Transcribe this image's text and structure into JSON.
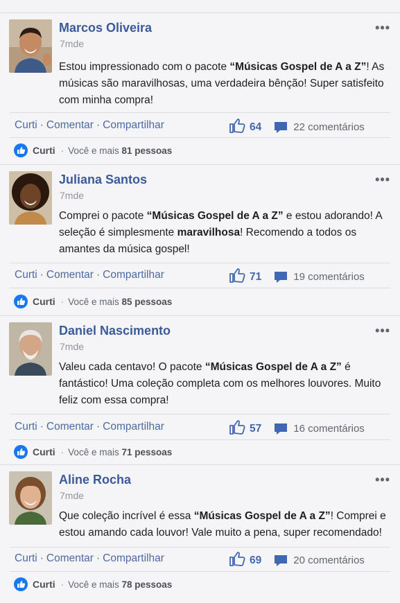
{
  "posts": [
    {
      "name": "Marcos Oliveira",
      "time": "7mde",
      "body_before": "Estou impressionado com o pacote ",
      "body_bold": "“Músicas Gospel de A a Z”",
      "body_after": "! As músicas são maravilhosas, uma verdadeira bênção! Super satisfeito com minha compra!",
      "action_like": "Curti",
      "action_comment": "Comentar",
      "action_share": "Compartilhar",
      "likes": "64",
      "comments": "22 comentários",
      "reaction_label": "Curti",
      "reaction_text": "Você e mais ",
      "reaction_count": "81 pessoas",
      "avatar_bg": "#8a6a52"
    },
    {
      "name": "Juliana Santos",
      "time": "7mde",
      "body_before": "Comprei o pacote ",
      "body_bold": "“Músicas Gospel de A a Z”",
      "body_after": " e estou adorando! A seleção é simplesmente ",
      "body_bold2": "maravilhosa",
      "body_after2": "! Recomendo a todos os amantes da música gospel!",
      "action_like": "Curti",
      "action_comment": "Comentar",
      "action_share": "Compartilhar",
      "likes": "71",
      "comments": "19 comentários",
      "reaction_label": "Curti",
      "reaction_text": "Você e mais ",
      "reaction_count": "85 pessoas",
      "avatar_bg": "#5a3a24"
    },
    {
      "name": "Daniel Nascimento",
      "time": "7mde",
      "body_before": "Valeu cada centavo! O pacote ",
      "body_bold": "“Músicas Gospel de A a Z”",
      "body_after": " é fantástico! Uma coleção completa com os melhores louvores. Muito feliz com essa compra!",
      "action_like": "Curti",
      "action_comment": "Comentar",
      "action_share": "Compartilhar",
      "likes": "57",
      "comments": "16 comentários",
      "reaction_label": "Curti",
      "reaction_text": "Você e mais ",
      "reaction_count": "71 pessoas",
      "avatar_bg": "#b7aa98"
    },
    {
      "name": "Aline Rocha",
      "time": "7mde",
      "body_before": "Que coleção incrível é essa ",
      "body_bold": "“Músicas Gospel de A a Z”",
      "body_after": "! Comprei e estou amando cada louvor! Vale muito a pena, super recomendado!",
      "action_like": "Curti",
      "action_comment": "Comentar",
      "action_share": "Compartilhar",
      "likes": "69",
      "comments": "20 comentários",
      "reaction_label": "Curti",
      "reaction_text": "Você e mais ",
      "reaction_count": "78 pessoas",
      "avatar_bg": "#9a7a5e"
    }
  ],
  "more_label": "•••",
  "colors": {
    "name": "#3b5a9c",
    "link": "#4b69a6",
    "like_blue": "#4267b2"
  }
}
